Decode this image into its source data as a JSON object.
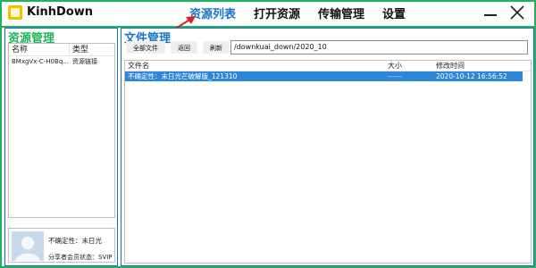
{
  "app": {
    "title": "KinhDown"
  },
  "nav": {
    "items": [
      "资源列表",
      "打开资源",
      "传输管理",
      "设置"
    ],
    "active_index": 0
  },
  "window_controls": {
    "minimize_icon": "minimize-icon",
    "close_icon": "close-icon"
  },
  "left": {
    "title": "资源管理",
    "columns": [
      "名称",
      "类型"
    ],
    "rows": [
      {
        "name": "BMxgVx-C-H0Bq...",
        "type": "资源链接"
      }
    ],
    "user": {
      "name": "不确定性：末日光",
      "status": "分享者会员状态：SVIP"
    }
  },
  "right": {
    "title": "文件管理",
    "buttons": [
      "全部文件",
      "返回",
      "刷新"
    ],
    "path": "/downkuai_down/2020_10",
    "columns": [
      "文件名",
      "大小",
      "修改时间"
    ],
    "rows": [
      {
        "name": "不确定性：末日光芒破解版_121310",
        "size": "------",
        "modified": "2020-10-12 16:56:52",
        "selected": true
      }
    ]
  },
  "colors": {
    "frame": "#1fb35a",
    "accent": "#1a73c9",
    "selected_row": "#2e86d9",
    "arrow": "#e02020"
  }
}
